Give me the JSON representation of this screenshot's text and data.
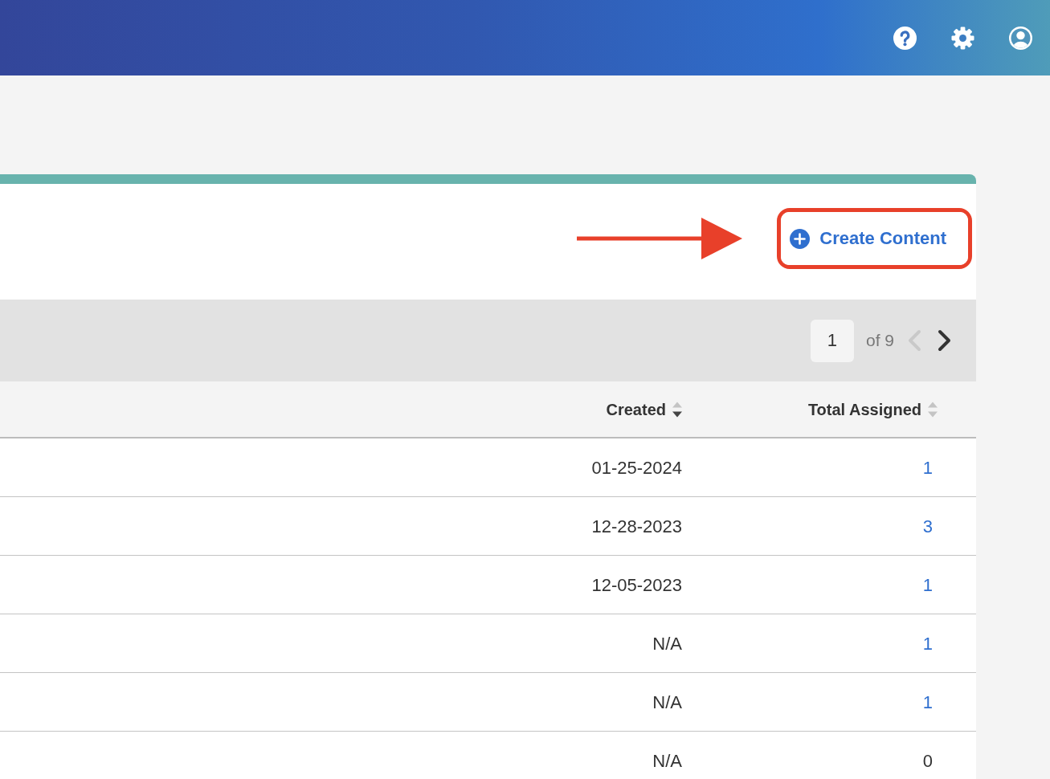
{
  "header": {
    "buttons": [
      {
        "kind": "help"
      },
      {
        "kind": "settings"
      },
      {
        "kind": "account"
      }
    ]
  },
  "create_button": {
    "label": "Create Content",
    "highlighted": true
  },
  "pagination": {
    "current_page": "1",
    "total_label": "of 9",
    "previous": {
      "disabled": true
    },
    "next": {
      "disabled": false
    }
  },
  "table": {
    "columns": [
      {
        "label": "Created",
        "sorted": true,
        "descending": true
      },
      {
        "label": "Total Assigned",
        "sorted": false
      }
    ],
    "rows": [
      {
        "created": "01-25-2024",
        "total_assigned": "1",
        "linked": true
      },
      {
        "created": "12-28-2023",
        "total_assigned": "3",
        "linked": true
      },
      {
        "created": "12-05-2023",
        "total_assigned": "1",
        "linked": true
      },
      {
        "created": "N/A",
        "total_assigned": "1",
        "linked": true
      },
      {
        "created": "N/A",
        "total_assigned": "1",
        "linked": true
      },
      {
        "created": "N/A",
        "total_assigned": "0",
        "linked": false
      }
    ]
  }
}
